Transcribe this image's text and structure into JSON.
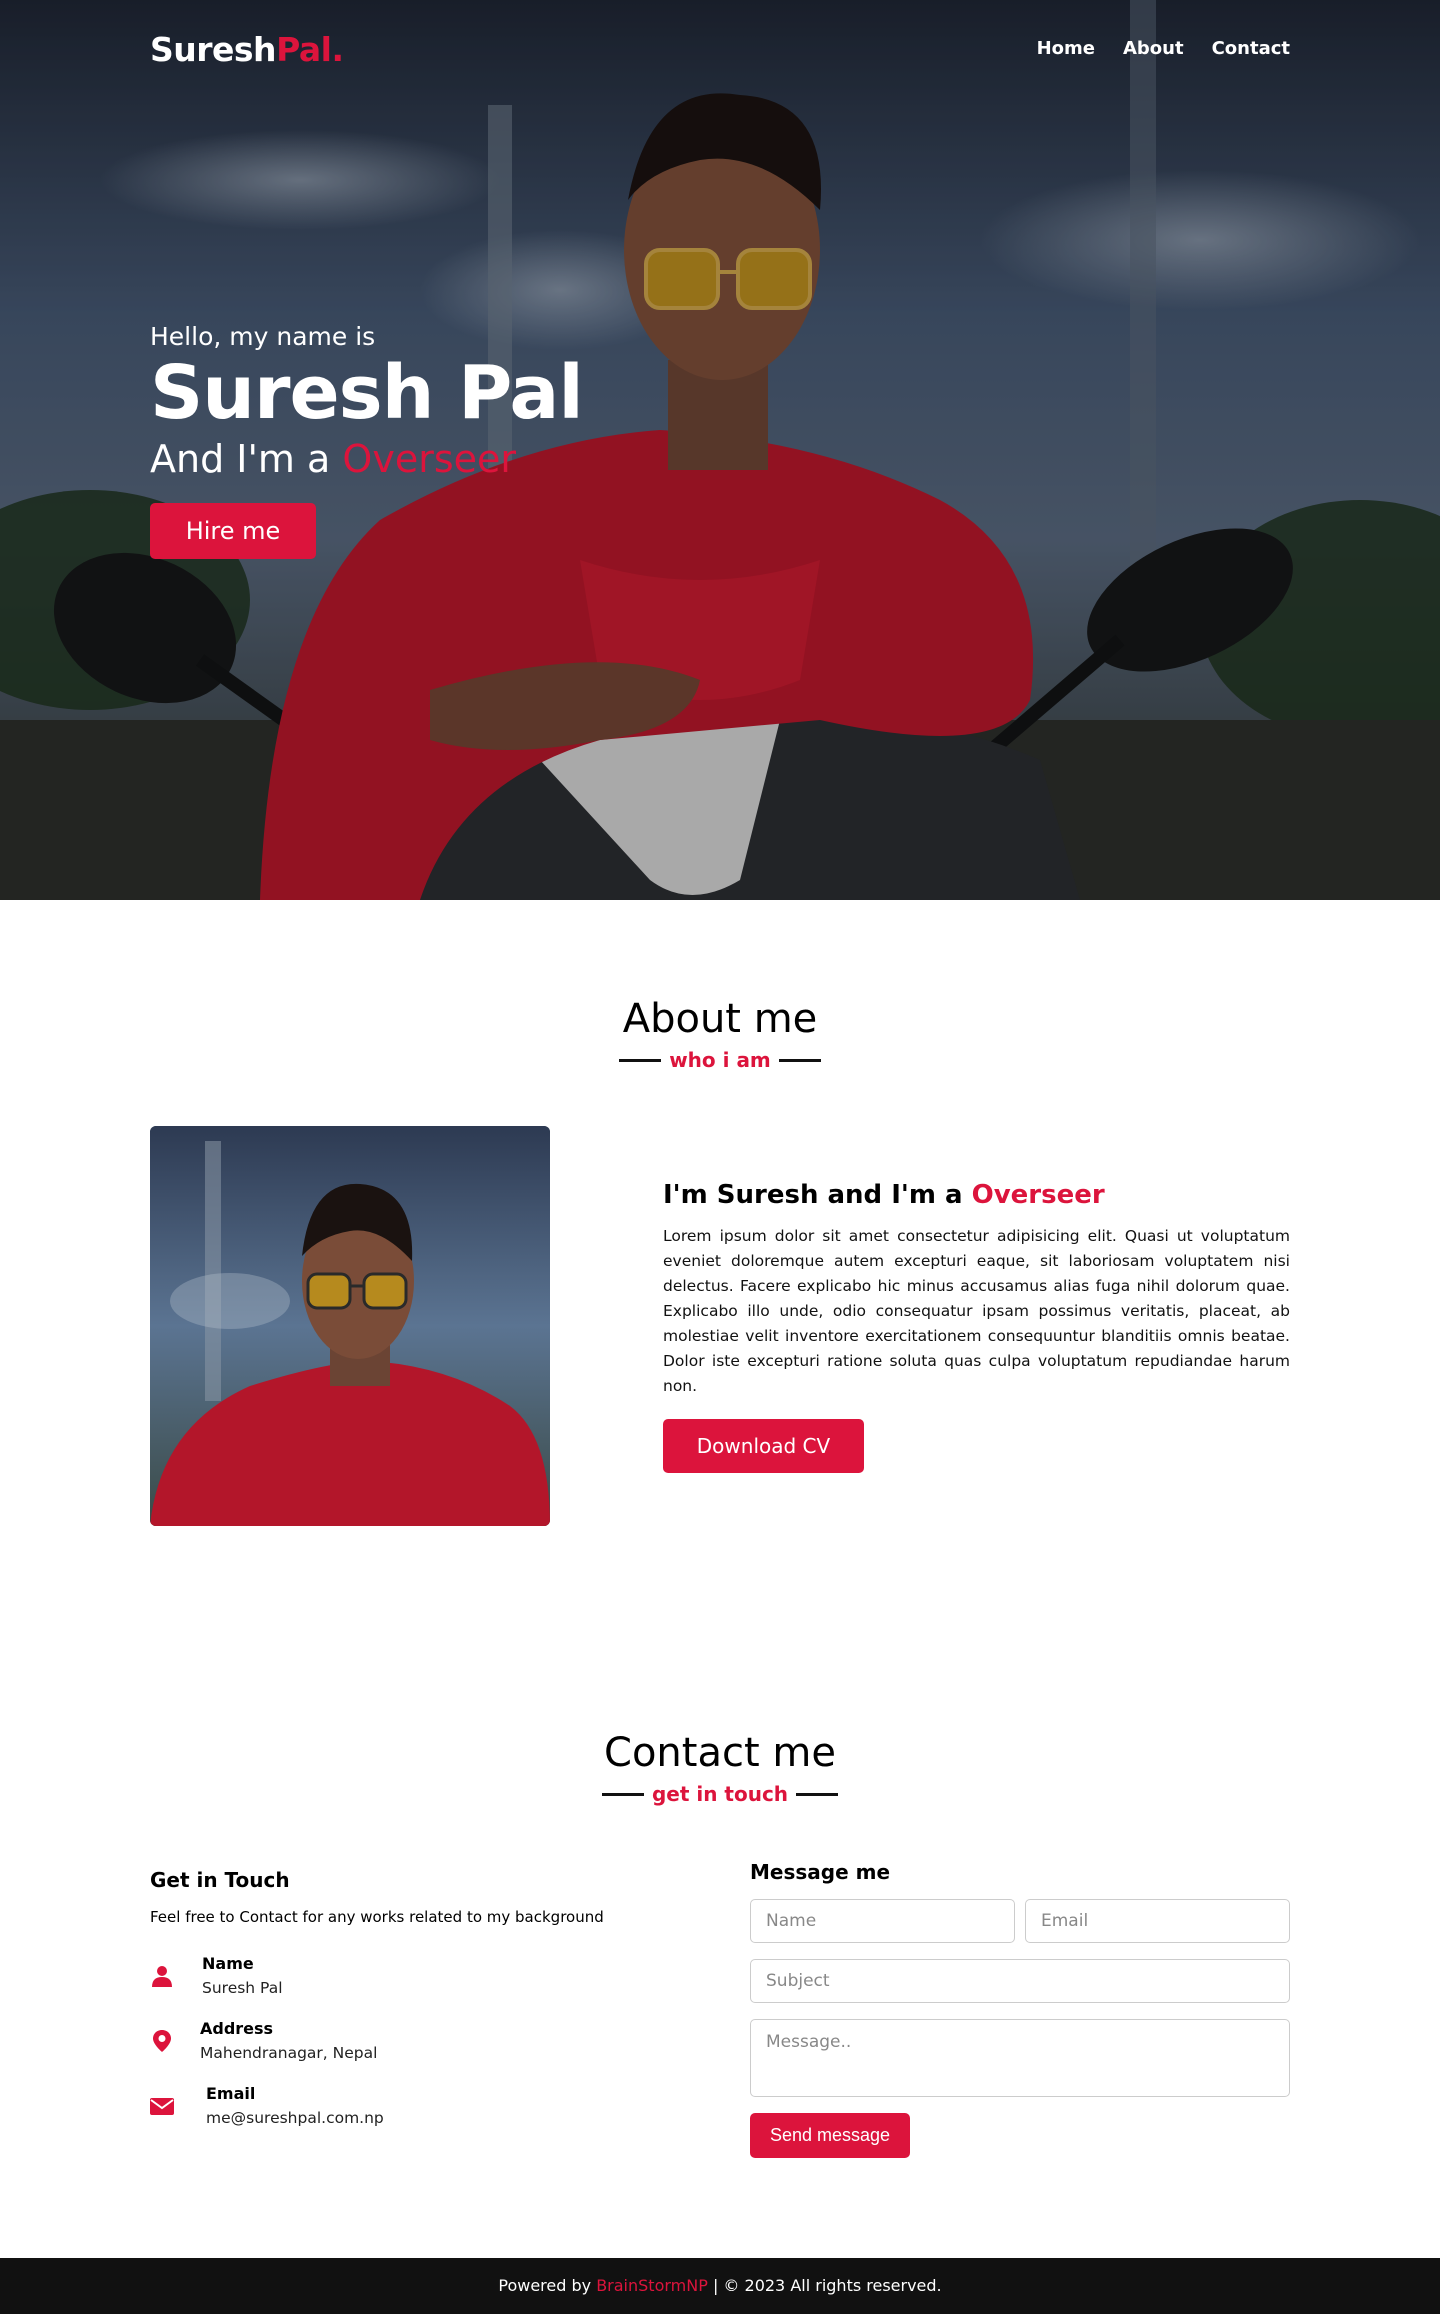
{
  "nav": {
    "logo_main": "Suresh",
    "logo_accent": "Pal.",
    "items": [
      "Home",
      "About",
      "Contact"
    ]
  },
  "hero": {
    "greeting": "Hello, my name is",
    "name": "Suresh Pal",
    "role_prefix": "And I'm a",
    "role": "Overseer",
    "cta": "Hire me"
  },
  "about": {
    "title": "About me",
    "subtitle": "who i am",
    "heading_prefix": "I'm Suresh and I'm a",
    "heading_role": "Overseer",
    "paragraph": "Lorem ipsum dolor sit amet consectetur adipisicing elit. Quasi ut voluptatum eveniet doloremque autem excepturi eaque, sit laboriosam voluptatem nisi delectus. Facere explicabo hic minus accusamus alias fuga nihil dolorum quae. Explicabo illo unde, odio consequatur ipsam possimus veritatis, placeat, ab molestiae velit inventore exercitationem consequuntur blanditiis omnis beatae. Dolor iste excepturi ratione soluta quas culpa voluptatum repudiandae harum non.",
    "cta": "Download CV"
  },
  "contact": {
    "title": "Contact me",
    "subtitle": "get in touch",
    "left": {
      "title": "Get in Touch",
      "description": "Feel free to Contact for any works related to my background",
      "items": [
        {
          "label": "Name",
          "value": "Suresh Pal",
          "icon": "user-icon"
        },
        {
          "label": "Address",
          "value": "Mahendranagar, Nepal",
          "icon": "map-marker-icon"
        },
        {
          "label": "Email",
          "value": "me@sureshpal.com.np",
          "icon": "envelope-icon"
        }
      ]
    },
    "form": {
      "title": "Message me",
      "name_placeholder": "Name",
      "email_placeholder": "Email",
      "subject_placeholder": "Subject",
      "message_placeholder": "Message..",
      "submit": "Send message"
    }
  },
  "footer": {
    "prefix": "Powered by",
    "brand": "BrainStormNP",
    "suffix": "| © 2023 All rights reserved."
  },
  "colors": {
    "accent": "#dc143c",
    "footer_bg": "#111111"
  }
}
